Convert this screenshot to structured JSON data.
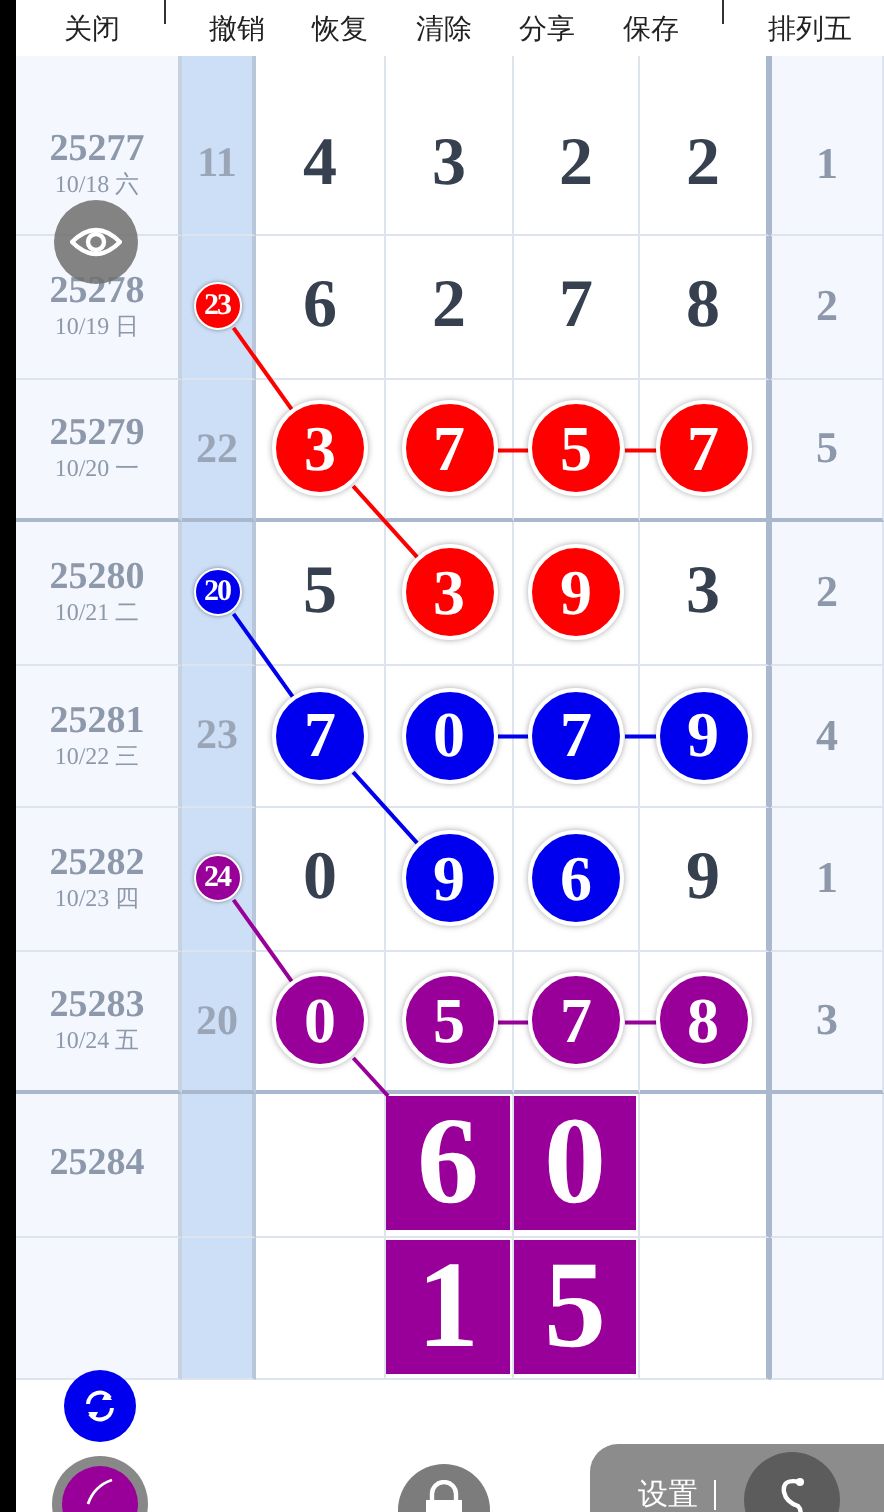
{
  "toolbar": [
    {
      "label": "关闭"
    },
    {
      "label": "撤销"
    },
    {
      "label": "恢复"
    },
    {
      "label": "清除"
    },
    {
      "label": "分享"
    },
    {
      "label": "保存"
    },
    {
      "label": "排列五"
    }
  ],
  "rows": [
    {
      "issue": "25277",
      "date": "10/18 六",
      "sum": "11",
      "last": "1",
      "cells": [
        {
          "kind": "plain",
          "digit": "4"
        },
        {
          "kind": "plain",
          "digit": "3"
        },
        {
          "kind": "plain",
          "digit": "2"
        },
        {
          "kind": "plain",
          "digit": "2"
        }
      ]
    },
    {
      "issue": "25278",
      "date": "10/19 日",
      "marker": {
        "text": "23",
        "color": "#ff0000"
      },
      "last": "2",
      "cells": [
        {
          "kind": "plain",
          "digit": "6"
        },
        {
          "kind": "plain",
          "digit": "2"
        },
        {
          "kind": "plain",
          "digit": "7"
        },
        {
          "kind": "plain",
          "digit": "8"
        }
      ]
    },
    {
      "issue": "25279",
      "date": "10/20 一",
      "sum": "22",
      "last": "5",
      "cells": [
        {
          "kind": "ball",
          "digit": "3",
          "color": "#ff0000",
          "link_right": false
        },
        {
          "kind": "ball",
          "digit": "7",
          "color": "#ff0000",
          "link_right": true
        },
        {
          "kind": "ball",
          "digit": "5",
          "color": "#ff0000",
          "link_right": true
        },
        {
          "kind": "ball",
          "digit": "7",
          "color": "#ff0000",
          "link_right": false
        }
      ]
    },
    {
      "issue": "25280",
      "date": "10/21 二",
      "marker": {
        "text": "20",
        "color": "#0000ee"
      },
      "last": "2",
      "cells": [
        {
          "kind": "plain",
          "digit": "5"
        },
        {
          "kind": "ball",
          "digit": "3",
          "color": "#ff0000",
          "link_right": false
        },
        {
          "kind": "ball",
          "digit": "9",
          "color": "#ff0000",
          "link_right": false
        },
        {
          "kind": "plain",
          "digit": "3"
        }
      ]
    },
    {
      "issue": "25281",
      "date": "10/22 三",
      "sum": "23",
      "last": "4",
      "cells": [
        {
          "kind": "ball",
          "digit": "7",
          "color": "#0000ee",
          "link_right": false
        },
        {
          "kind": "ball",
          "digit": "0",
          "color": "#0000ee",
          "link_right": true
        },
        {
          "kind": "ball",
          "digit": "7",
          "color": "#0000ee",
          "link_right": true
        },
        {
          "kind": "ball",
          "digit": "9",
          "color": "#0000ee",
          "link_right": false
        }
      ]
    },
    {
      "issue": "25282",
      "date": "10/23 四",
      "marker": {
        "text": "24",
        "color": "#990099"
      },
      "last": "1",
      "cells": [
        {
          "kind": "plain",
          "digit": "0"
        },
        {
          "kind": "ball",
          "digit": "9",
          "color": "#0000ee",
          "link_right": false
        },
        {
          "kind": "ball",
          "digit": "6",
          "color": "#0000ee",
          "link_right": false
        },
        {
          "kind": "plain",
          "digit": "9"
        }
      ]
    },
    {
      "issue": "25283",
      "date": "10/24 五",
      "sum": "20",
      "last": "3",
      "cells": [
        {
          "kind": "ball",
          "digit": "0",
          "color": "#990099",
          "link_right": false
        },
        {
          "kind": "ball",
          "digit": "5",
          "color": "#990099",
          "link_right": true
        },
        {
          "kind": "ball",
          "digit": "7",
          "color": "#990099",
          "link_right": true
        },
        {
          "kind": "ball",
          "digit": "8",
          "color": "#990099",
          "link_right": false
        }
      ]
    },
    {
      "issue": "25284",
      "cells": [
        {
          "kind": "empty"
        },
        {
          "kind": "square",
          "digit": "6",
          "color": "#990099"
        },
        {
          "kind": "square",
          "digit": "0",
          "color": "#990099"
        },
        {
          "kind": "empty"
        }
      ]
    },
    {
      "cells": [
        {
          "kind": "empty"
        },
        {
          "kind": "square",
          "digit": "1",
          "color": "#990099"
        },
        {
          "kind": "square",
          "digit": "5",
          "color": "#990099"
        },
        {
          "kind": "empty"
        }
      ]
    }
  ],
  "settings_panel": {
    "label": "设置"
  }
}
